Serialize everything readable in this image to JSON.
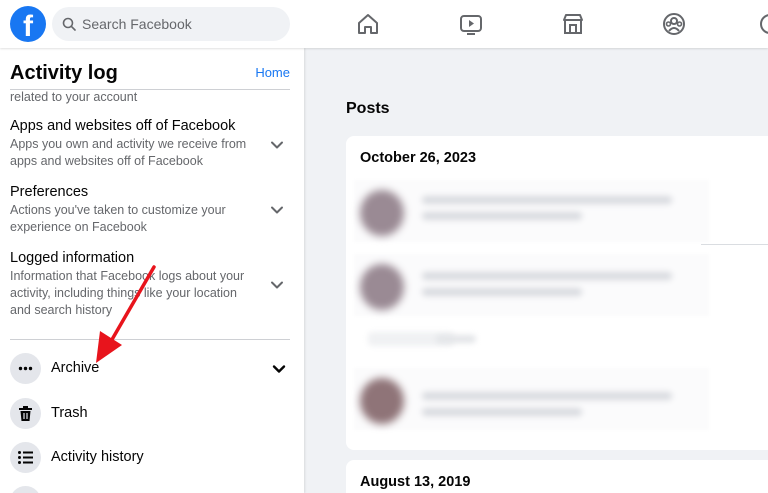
{
  "topbar": {
    "search_placeholder": "Search Facebook",
    "nav_icons": [
      "home-icon",
      "watch-icon",
      "marketplace-icon",
      "groups-icon"
    ]
  },
  "sidebar": {
    "title": "Activity log",
    "home_link": "Home",
    "cut_text": "related to your account",
    "sections": [
      {
        "title": "Apps and websites off of Facebook",
        "desc": "Apps you own and activity we receive from apps and websites off of Facebook"
      },
      {
        "title": "Preferences",
        "desc": "Actions you've taken to customize your experience on Facebook"
      },
      {
        "title": "Logged information",
        "desc": "Information that Facebook logs about your activity, including things like your location and search history"
      }
    ],
    "menu": [
      {
        "label": "Archive",
        "icon": "more-dots-icon"
      },
      {
        "label": "Trash",
        "icon": "trash-icon"
      },
      {
        "label": "Activity history",
        "icon": "list-icon"
      }
    ]
  },
  "main": {
    "heading": "Posts",
    "groups": [
      {
        "date": "October 26, 2023"
      },
      {
        "date": "August 13, 2019"
      }
    ]
  },
  "colors": {
    "brand": "#1877f2",
    "annotation": "#e8141c"
  }
}
